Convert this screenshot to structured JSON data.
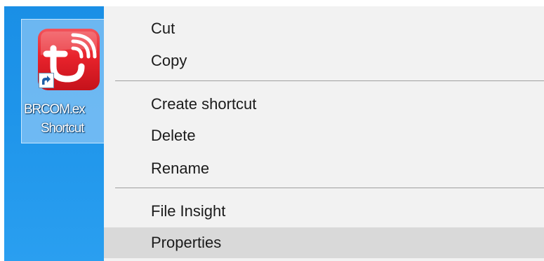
{
  "desktop": {
    "shortcut_label_line1": "BRCOM.ex",
    "shortcut_label_line2": "Shortcut",
    "icon": "app-logo-icon",
    "overlay_icon": "shortcut-arrow-icon",
    "background_color": "#1f95ea",
    "icon_color": "#e8232c"
  },
  "context_menu": {
    "items": [
      {
        "label": "Cut"
      },
      {
        "label": "Copy"
      },
      {
        "label": "Create shortcut"
      },
      {
        "label": "Delete"
      },
      {
        "label": "Rename"
      },
      {
        "label": "File Insight"
      },
      {
        "label": "Properties",
        "highlighted": true
      }
    ],
    "background_color": "#f2f2f2",
    "highlight_color": "#d9d9d9"
  }
}
